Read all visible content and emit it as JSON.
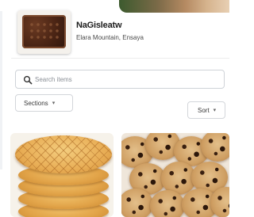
{
  "product": {
    "title": "NaGisleatw",
    "subtitle": "Elara Mountain, Ensaya"
  },
  "search": {
    "placeholder": "Search items",
    "value": ""
  },
  "filters": {
    "sections_label": "Sections",
    "sort_label": "Sort"
  },
  "icons": {
    "search": "search-icon",
    "sections_chevron": "chevron-down-icon",
    "sort_chevron": "chevron-down-icon"
  },
  "colors": {
    "border": "#cfd3d8",
    "text_dark": "#1c1c1c"
  }
}
